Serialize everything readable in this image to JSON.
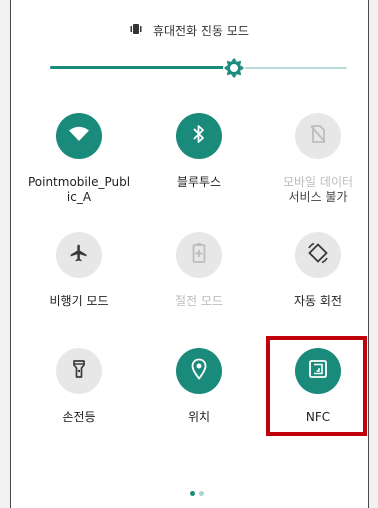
{
  "header": {
    "mode_text": "휴대전화 진동 모드",
    "icon": "vibrate-icon"
  },
  "brightness": {
    "level": 0.62,
    "icon": "brightness-gear-icon"
  },
  "tiles": [
    {
      "id": "wifi",
      "label": "Pointmobile_Public_A",
      "label_line1": "Pointmobile_Publ",
      "label_line2": "ic_A",
      "state": "on",
      "icon": "wifi-icon"
    },
    {
      "id": "bluetooth",
      "label": "블루투스",
      "state": "on",
      "icon": "bluetooth-icon"
    },
    {
      "id": "mobile-data",
      "label": "모바일 데이터",
      "sublabel": "서비스 불가",
      "state": "unavailable",
      "icon": "no-sim-icon"
    },
    {
      "id": "airplane",
      "label": "비행기 모드",
      "state": "off",
      "icon": "airplane-icon"
    },
    {
      "id": "battery-saver",
      "label": "절전 모드",
      "state": "unavailable",
      "icon": "battery-saver-icon"
    },
    {
      "id": "auto-rotate",
      "label": "자동 회전",
      "state": "off",
      "icon": "auto-rotate-icon"
    },
    {
      "id": "flashlight",
      "label": "손전등",
      "state": "off",
      "icon": "flashlight-icon"
    },
    {
      "id": "location",
      "label": "위치",
      "state": "on",
      "icon": "location-icon"
    },
    {
      "id": "nfc",
      "label": "NFC",
      "state": "on",
      "icon": "nfc-icon"
    }
  ],
  "pager": {
    "pages": 2,
    "current": 1
  },
  "colors": {
    "accent": "#1a8a7a",
    "highlight": "#c0000a",
    "inactive_tile": "#e7e7e7"
  }
}
